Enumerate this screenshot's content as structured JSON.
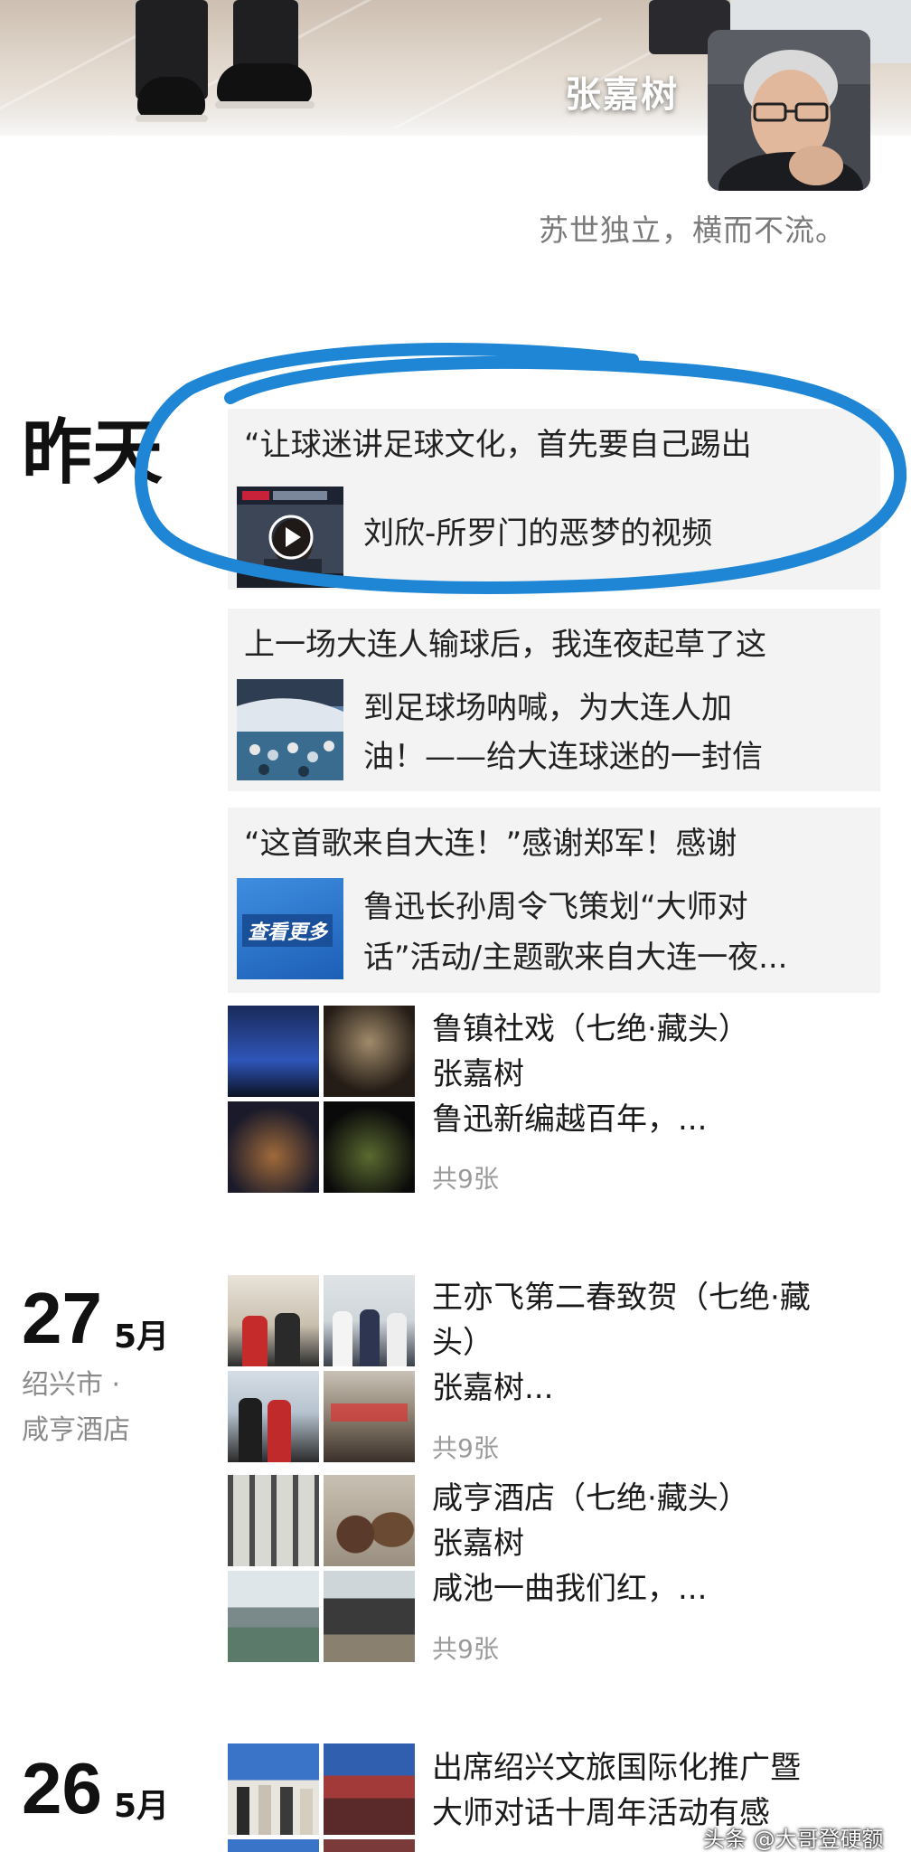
{
  "profile": {
    "nickname": "张嘉树",
    "signature": "苏世独立，横而不流。"
  },
  "feed": {
    "yesterday": {
      "day_label": "昨天",
      "shares": [
        {
          "title": "“让球迷讲足球文化，首先要自己踢出",
          "desc_lines": [
            "刘欣-所罗门的恶梦的视频"
          ],
          "thumb": "video-play-icon"
        },
        {
          "title": "上一场大连人输球后，我连夜起草了这",
          "desc_lines": [
            "到足球场呐喊，为大连人加",
            "油！——给大连球迷的一封信"
          ],
          "thumb": "stadium-photo"
        },
        {
          "title": "“这首歌来自大连！”感谢郑军！感谢",
          "desc_lines": [
            "鲁迅长孙周令飞策划“大师对",
            "话”活动/主题歌来自大连一夜..."
          ],
          "thumb": "查看更多"
        }
      ],
      "photo_posts": [
        {
          "lines": [
            "鲁镇社戏（七绝·藏头）",
            "张嘉树",
            "鲁迅新编越百年，..."
          ],
          "count": "共9张"
        }
      ]
    },
    "may27": {
      "day": "27",
      "month": "5月",
      "location_lines": [
        "绍兴市 ·",
        "咸亨酒店"
      ],
      "photo_posts": [
        {
          "lines": [
            "王亦飞第二春致贺（七绝·藏",
            "头）",
            "张嘉树..."
          ],
          "count": "共9张"
        },
        {
          "lines": [
            "咸亨酒店（七绝·藏头）",
            "张嘉树",
            "咸池一曲我们红，..."
          ],
          "count": "共9张"
        }
      ]
    },
    "may26": {
      "day": "26",
      "month": "5月",
      "photo_posts": [
        {
          "lines": [
            "出席绍兴文旅国际化推广暨",
            "大师对话十周年活动有感"
          ]
        }
      ]
    }
  },
  "watermark": "头条 @大哥登硬额",
  "colors": {
    "highlight_circle": "#1f86d6",
    "card_bg": "#f3f3f3",
    "secondary_text": "#8a8a8a"
  }
}
